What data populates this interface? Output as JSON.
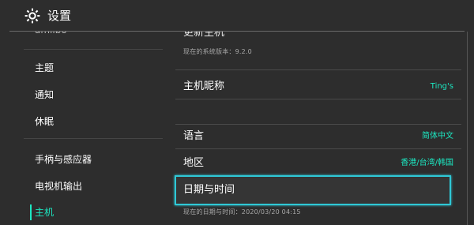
{
  "header": {
    "title": "设置",
    "icon": "gear-icon"
  },
  "sidebar": {
    "cut_item": "amiibo",
    "items": [
      {
        "label": "主题"
      },
      {
        "label": "通知"
      },
      {
        "label": "休眠"
      },
      {
        "label": "手柄与感应器"
      },
      {
        "label": "电视机输出"
      },
      {
        "label": "主机"
      }
    ],
    "active_index": 5
  },
  "main": {
    "update_label_cut": "更新主机",
    "system_version": "现在的系统版本：9.2.0",
    "rows": [
      {
        "label": "主机昵称",
        "value": "Ting's"
      },
      {
        "label": "语言",
        "value": "简体中文"
      },
      {
        "label": "地区",
        "value": "香港/台湾/韩国"
      },
      {
        "label": "日期与时间",
        "value": ""
      }
    ],
    "datetime_caption": "现在的日期与时间：2020/03/20 04:15"
  },
  "colors": {
    "background": "#2d2d2d",
    "accent": "#1ce8c2",
    "selection_border": "#2fc8d6"
  }
}
